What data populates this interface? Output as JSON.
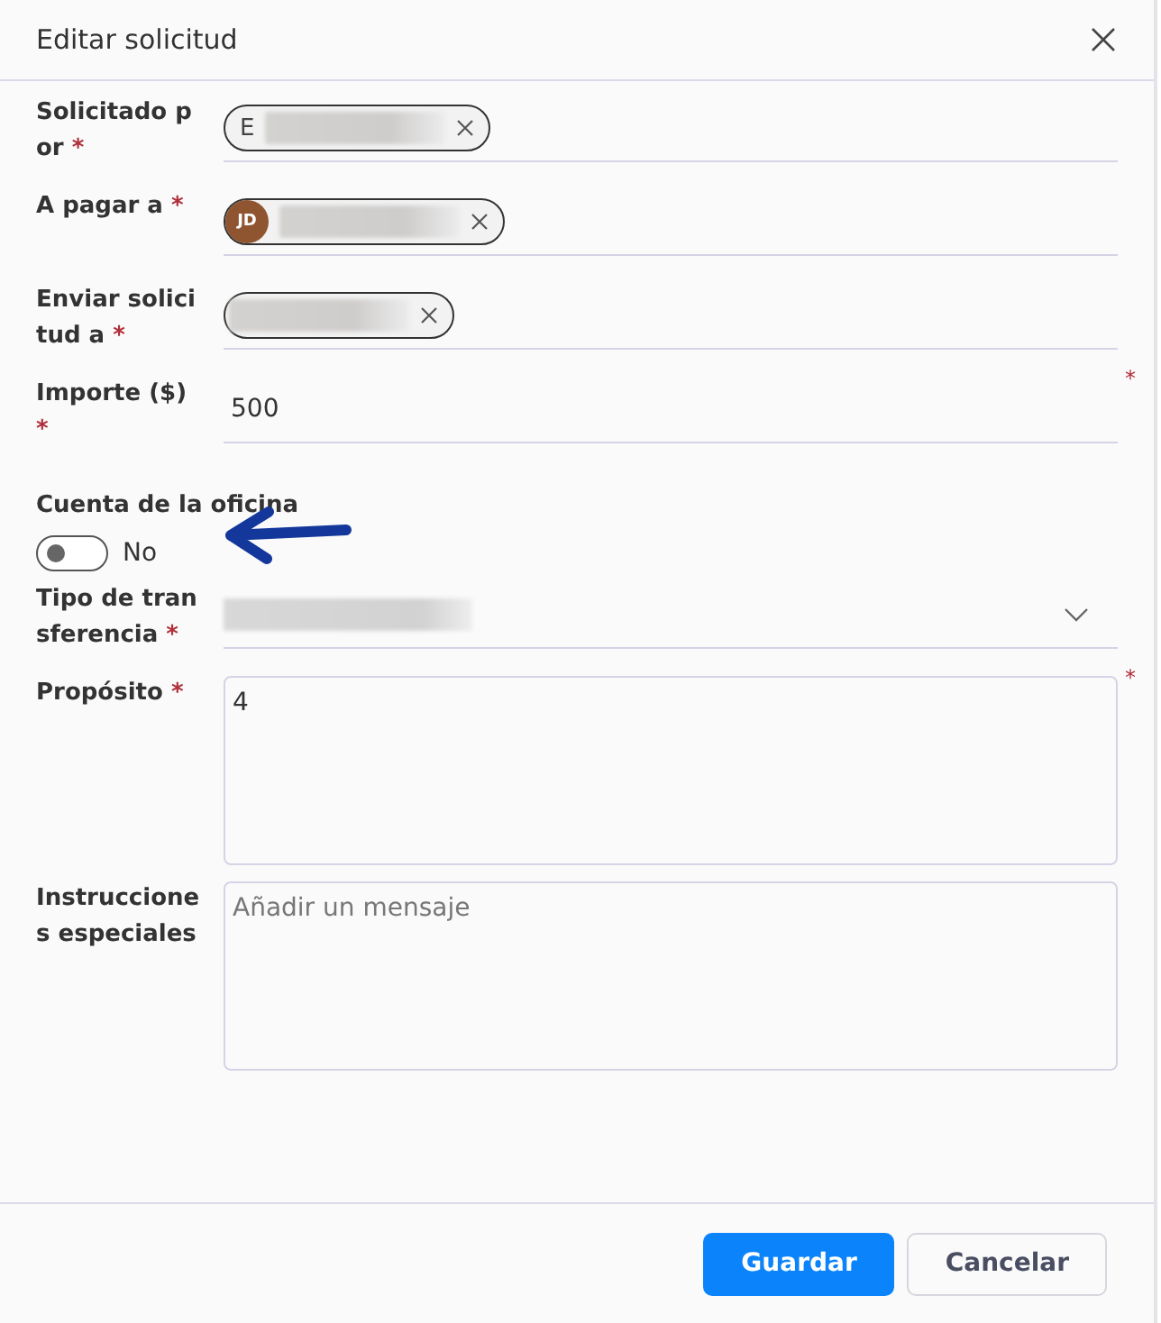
{
  "dialog": {
    "title": "Editar solicitud"
  },
  "fields": [
    {
      "kind": "chip",
      "label": "Solicitado por",
      "required_mark": "*",
      "chip": {
        "initial": "E"
      }
    },
    {
      "kind": "chip",
      "label": "A pagar a",
      "required_mark": "*",
      "chip": {
        "avatar": "JD"
      }
    },
    {
      "kind": "chip",
      "label": "Enviar solicitud a",
      "required_mark": "*"
    },
    {
      "kind": "text",
      "label": "Importe ($)",
      "required_mark": "*",
      "value": "500",
      "field_mark": "*"
    },
    {
      "kind": "toggle",
      "label": "Cuenta de la oficina",
      "on": false,
      "state_label": "No"
    },
    {
      "kind": "select",
      "label": "Tipo de transferencia",
      "required_mark": "*"
    },
    {
      "kind": "textarea",
      "label": "Propósito",
      "required_mark": "*",
      "value": "4",
      "field_mark": "*"
    },
    {
      "kind": "textarea",
      "label": "Instrucciones especiales",
      "placeholder": "Añadir un mensaje"
    }
  ],
  "buttons": [
    {
      "label": "Guardar",
      "primary": true
    },
    {
      "label": "Cancelar",
      "primary": false
    }
  ]
}
